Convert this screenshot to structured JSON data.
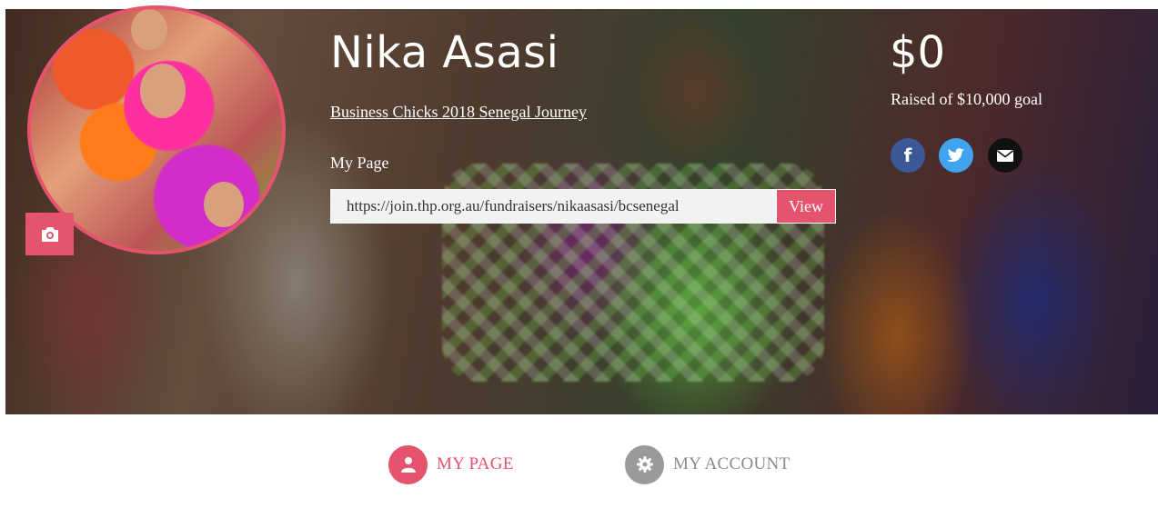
{
  "profile": {
    "name": "Nika Asasi",
    "campaign": "Business Chicks 2018 Senegal Journey",
    "my_page_label": "My Page",
    "page_url": "https://join.thp.org.au/fundraisers/nikaasasi/bcsenegal",
    "view_label": "View"
  },
  "fundraising": {
    "raised": "$0",
    "goal_text": "Raised of $10,000 goal"
  },
  "social": {
    "facebook_glyph": "f"
  },
  "tabs": [
    {
      "label": "MY PAGE",
      "active": true,
      "icon": "user-icon"
    },
    {
      "label": "MY ACCOUNT",
      "active": false,
      "icon": "gear-icon"
    }
  ],
  "colors": {
    "accent": "#e5536e",
    "facebook": "#3b5998",
    "twitter": "#3fa3ef",
    "email": "#111111",
    "inactive": "#9a9a9a"
  }
}
